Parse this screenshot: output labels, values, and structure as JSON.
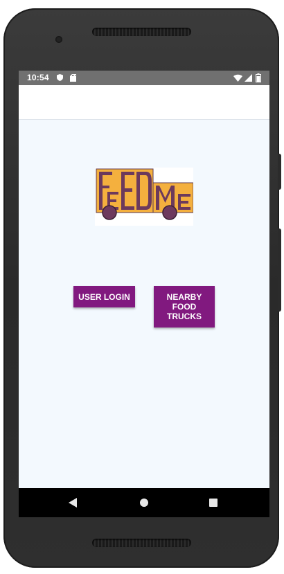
{
  "status_bar": {
    "time": "10:54",
    "icons": [
      "shield-icon",
      "sd-card-icon",
      "wifi-icon",
      "signal-icon",
      "battery-icon"
    ]
  },
  "app": {
    "logo_text": "FEEDME",
    "logo_colors": {
      "orange": "#f4b03e",
      "purple": "#6c3a5c"
    }
  },
  "buttons": {
    "user_login": "USER LOGIN",
    "nearby_food_trucks": "NEARBY FOOD TRUCKS"
  },
  "nav_bar": {
    "icons": [
      "back-icon",
      "home-icon",
      "recents-icon"
    ]
  },
  "colors": {
    "button": "#81197f",
    "screen_background": "#f3f9fe",
    "status_bar": "#707070"
  }
}
